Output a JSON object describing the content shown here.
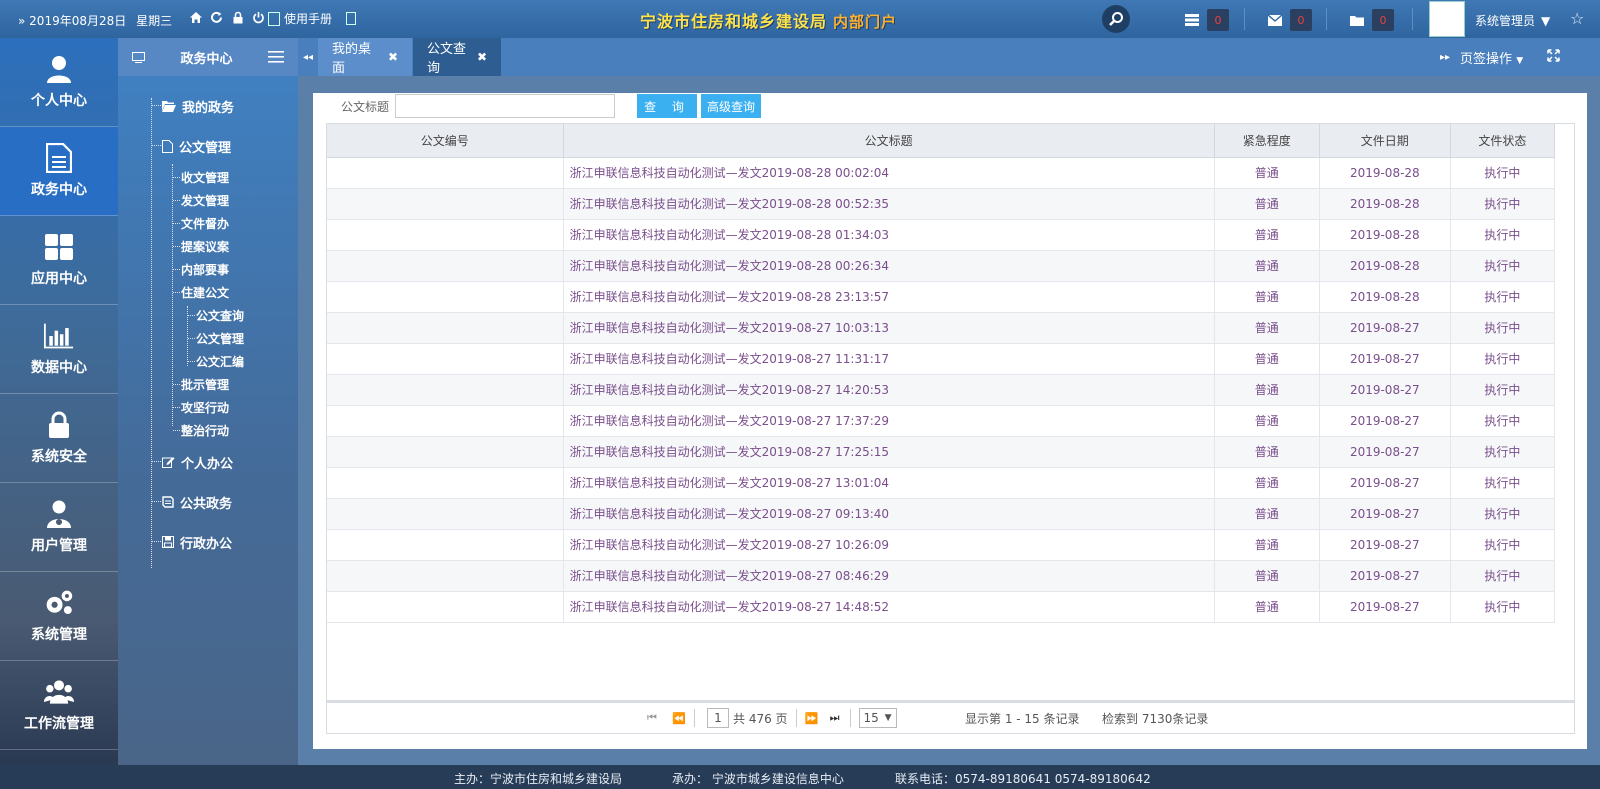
{
  "topbar": {
    "date": "2019年08月28日",
    "weekday": "星期三",
    "manual": "使用手册",
    "brand": "宁波市住房和城乡建设局",
    "brand_sub": "内部门户",
    "counts": {
      "tasks": "0",
      "mail": "0",
      "files": "0"
    },
    "user": "系统管理员"
  },
  "leftnav": [
    {
      "label": "个人中心",
      "icon": "user-icon"
    },
    {
      "label": "政务中心",
      "icon": "document-icon",
      "active": true
    },
    {
      "label": "应用中心",
      "icon": "grid-icon"
    },
    {
      "label": "数据中心",
      "icon": "bar-chart-icon"
    },
    {
      "label": "系统安全",
      "icon": "lock-icon"
    },
    {
      "label": "用户管理",
      "icon": "user-manage-icon"
    },
    {
      "label": "系统管理",
      "icon": "gears-icon"
    },
    {
      "label": "工作流管理",
      "icon": "group-icon"
    }
  ],
  "subnav": {
    "title": "政务中心",
    "groups": {
      "my_affairs": "我的政务",
      "doc_mgmt": "公文管理",
      "personal": "个人办公",
      "public": "公共政务",
      "admin": "行政办公"
    },
    "doc_children": [
      "收文管理",
      "发文管理",
      "文件督办",
      "提案议案",
      "内部要事",
      "住建公文",
      "公文查询",
      "公文管理",
      "公文汇编",
      "批示管理",
      "攻坚行动",
      "整治行动"
    ]
  },
  "tabs": {
    "t1": "我的桌面",
    "t2": "公文查询",
    "page_ops": "页签操作"
  },
  "query": {
    "label": "公文标题",
    "search_btn": "查 询",
    "advanced_btn": "高级查询"
  },
  "table": {
    "headers": [
      "公文编号",
      "公文标题",
      "紧急程度",
      "文件日期",
      "文件状态"
    ],
    "rows": [
      [
        "",
        "浙江申联信息科技自动化测试—发文2019-08-28 00:02:04",
        "普通",
        "2019-08-28",
        "执行中"
      ],
      [
        "",
        "浙江申联信息科技自动化测试—发文2019-08-28 00:52:35",
        "普通",
        "2019-08-28",
        "执行中"
      ],
      [
        "",
        "浙江申联信息科技自动化测试—发文2019-08-28 01:34:03",
        "普通",
        "2019-08-28",
        "执行中"
      ],
      [
        "",
        "浙江申联信息科技自动化测试—发文2019-08-28 00:26:34",
        "普通",
        "2019-08-28",
        "执行中"
      ],
      [
        "",
        "浙江申联信息科技自动化测试—发文2019-08-28 23:13:57",
        "普通",
        "2019-08-28",
        "执行中"
      ],
      [
        "",
        "浙江申联信息科技自动化测试—发文2019-08-27 10:03:13",
        "普通",
        "2019-08-27",
        "执行中"
      ],
      [
        "",
        "浙江申联信息科技自动化测试—发文2019-08-27 11:31:17",
        "普通",
        "2019-08-27",
        "执行中"
      ],
      [
        "",
        "浙江申联信息科技自动化测试—发文2019-08-27 14:20:53",
        "普通",
        "2019-08-27",
        "执行中"
      ],
      [
        "",
        "浙江申联信息科技自动化测试—发文2019-08-27 17:37:29",
        "普通",
        "2019-08-27",
        "执行中"
      ],
      [
        "",
        "浙江申联信息科技自动化测试—发文2019-08-27 17:25:15",
        "普通",
        "2019-08-27",
        "执行中"
      ],
      [
        "",
        "浙江申联信息科技自动化测试—发文2019-08-27 13:01:04",
        "普通",
        "2019-08-27",
        "执行中"
      ],
      [
        "",
        "浙江申联信息科技自动化测试—发文2019-08-27 09:13:40",
        "普通",
        "2019-08-27",
        "执行中"
      ],
      [
        "",
        "浙江申联信息科技自动化测试—发文2019-08-27 10:26:09",
        "普通",
        "2019-08-27",
        "执行中"
      ],
      [
        "",
        "浙江申联信息科技自动化测试—发文2019-08-27 08:46:29",
        "普通",
        "2019-08-27",
        "执行中"
      ],
      [
        "",
        "浙江申联信息科技自动化测试—发文2019-08-27 14:48:52",
        "普通",
        "2019-08-27",
        "执行中"
      ]
    ]
  },
  "pager": {
    "page": "1",
    "total_pages": "共 476 页",
    "page_size": "15",
    "showing": "显示第 1 - 15 条记录",
    "found": "检索到 7130条记录"
  },
  "footer": {
    "host": "主办：宁波市住房和城乡建设局",
    "undertaker": "承办：  宁波市城乡建设信息中心",
    "phone": "联系电话：0574-89180641 0574-89180642"
  }
}
